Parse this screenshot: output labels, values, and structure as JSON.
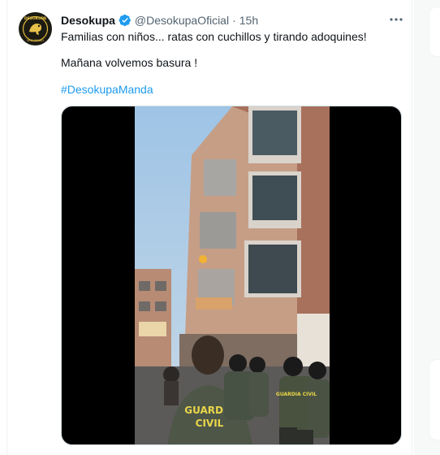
{
  "tweet": {
    "display_name": "Desokupa",
    "handle": "@DesokupaOficial",
    "separator": "·",
    "time": "15h",
    "line1": "Familias con niños... ratas con cuchillos y tirando adoquines!",
    "line2": "Mañana volvemos basura !",
    "hashtag": "#DesokupaManda"
  },
  "avatar": {
    "logo_text": "DESOKUPA",
    "subtext": "SEGURIDAD"
  },
  "media": {
    "vest_text_line1": "GUARDIA",
    "vest_text_line2": "CIVIL",
    "small_vest_text": "GUARDIA CIVIL"
  },
  "icons": {
    "verified": "verified-badge-icon",
    "more": "more-options-icon"
  },
  "colors": {
    "accent": "#1d9bf0",
    "muted": "#536471",
    "text": "#0f1419"
  }
}
